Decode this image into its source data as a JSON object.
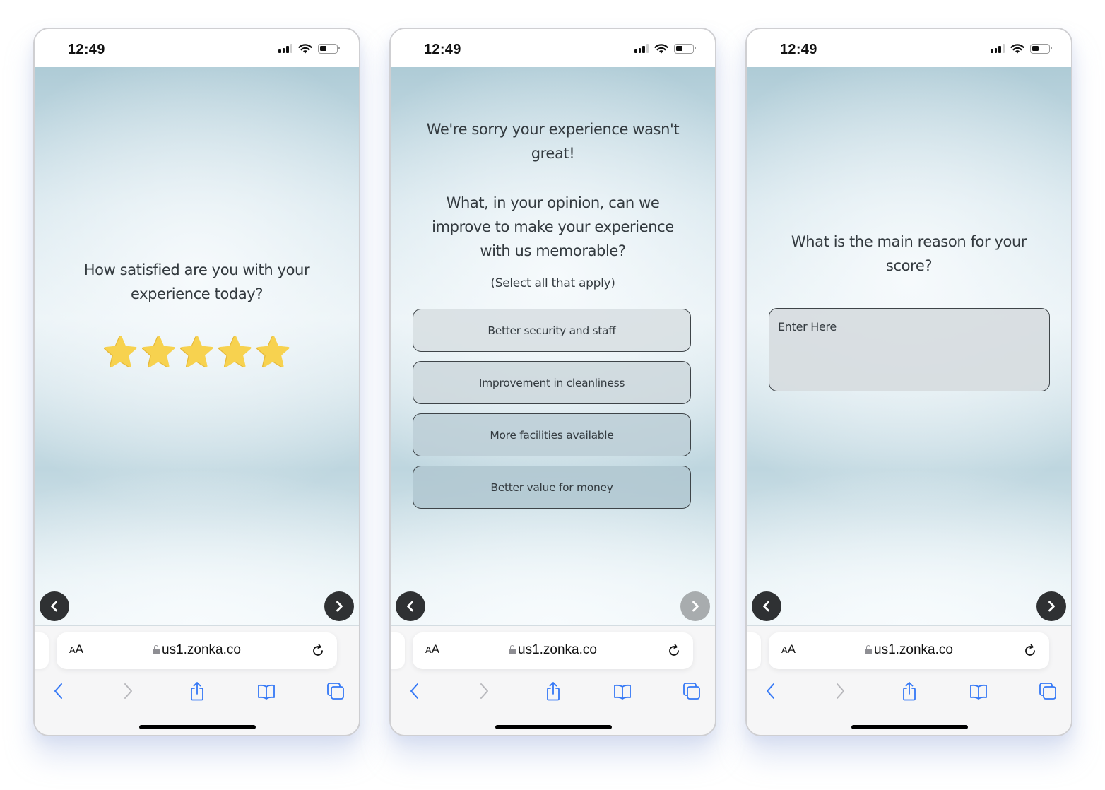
{
  "colors": {
    "ios_blue": "#3478f6",
    "nav_button": "#2f3133",
    "nav_button_disabled": "#a8acae",
    "star": "#f7d24f",
    "text": "#333a3f"
  },
  "phones": [
    {
      "status": {
        "time": "12:49"
      },
      "survey": {
        "question": "How satisfied are you with your experience today?",
        "rating": {
          "value": 5,
          "max": 5,
          "icon": "star-icon"
        },
        "prev_icon": "chevron-left-icon",
        "next_icon": "chevron-right-icon",
        "next_enabled": true
      },
      "browser": {
        "aa_label_small": "A",
        "aa_label_large": "A",
        "url": "us1.zonka.co"
      }
    },
    {
      "status": {
        "time": "12:49"
      },
      "survey": {
        "question_line1": "We're sorry your experience wasn't great!",
        "question_line2": "What, in your opinion, can we improve to make your experience with us memorable?",
        "subnote": "(Select all that apply)",
        "options": [
          {
            "label": "Better security and staff"
          },
          {
            "label": "Improvement in cleanliness"
          },
          {
            "label": "More facilities available"
          },
          {
            "label": "Better value for money"
          }
        ],
        "prev_icon": "chevron-left-icon",
        "next_icon": "chevron-right-icon",
        "next_enabled": false
      },
      "browser": {
        "aa_label_small": "A",
        "aa_label_large": "A",
        "url": "us1.zonka.co"
      }
    },
    {
      "status": {
        "time": "12:49"
      },
      "survey": {
        "question": "What is the main reason for your score?",
        "input": {
          "value": "",
          "placeholder": "Enter Here"
        },
        "prev_icon": "chevron-left-icon",
        "next_icon": "chevron-right-icon",
        "next_enabled": true
      },
      "browser": {
        "aa_label_small": "A",
        "aa_label_large": "A",
        "url": "us1.zonka.co"
      }
    }
  ],
  "toolbar_icons": [
    "back-icon",
    "forward-icon",
    "share-icon",
    "bookmarks-icon",
    "tabs-icon"
  ]
}
